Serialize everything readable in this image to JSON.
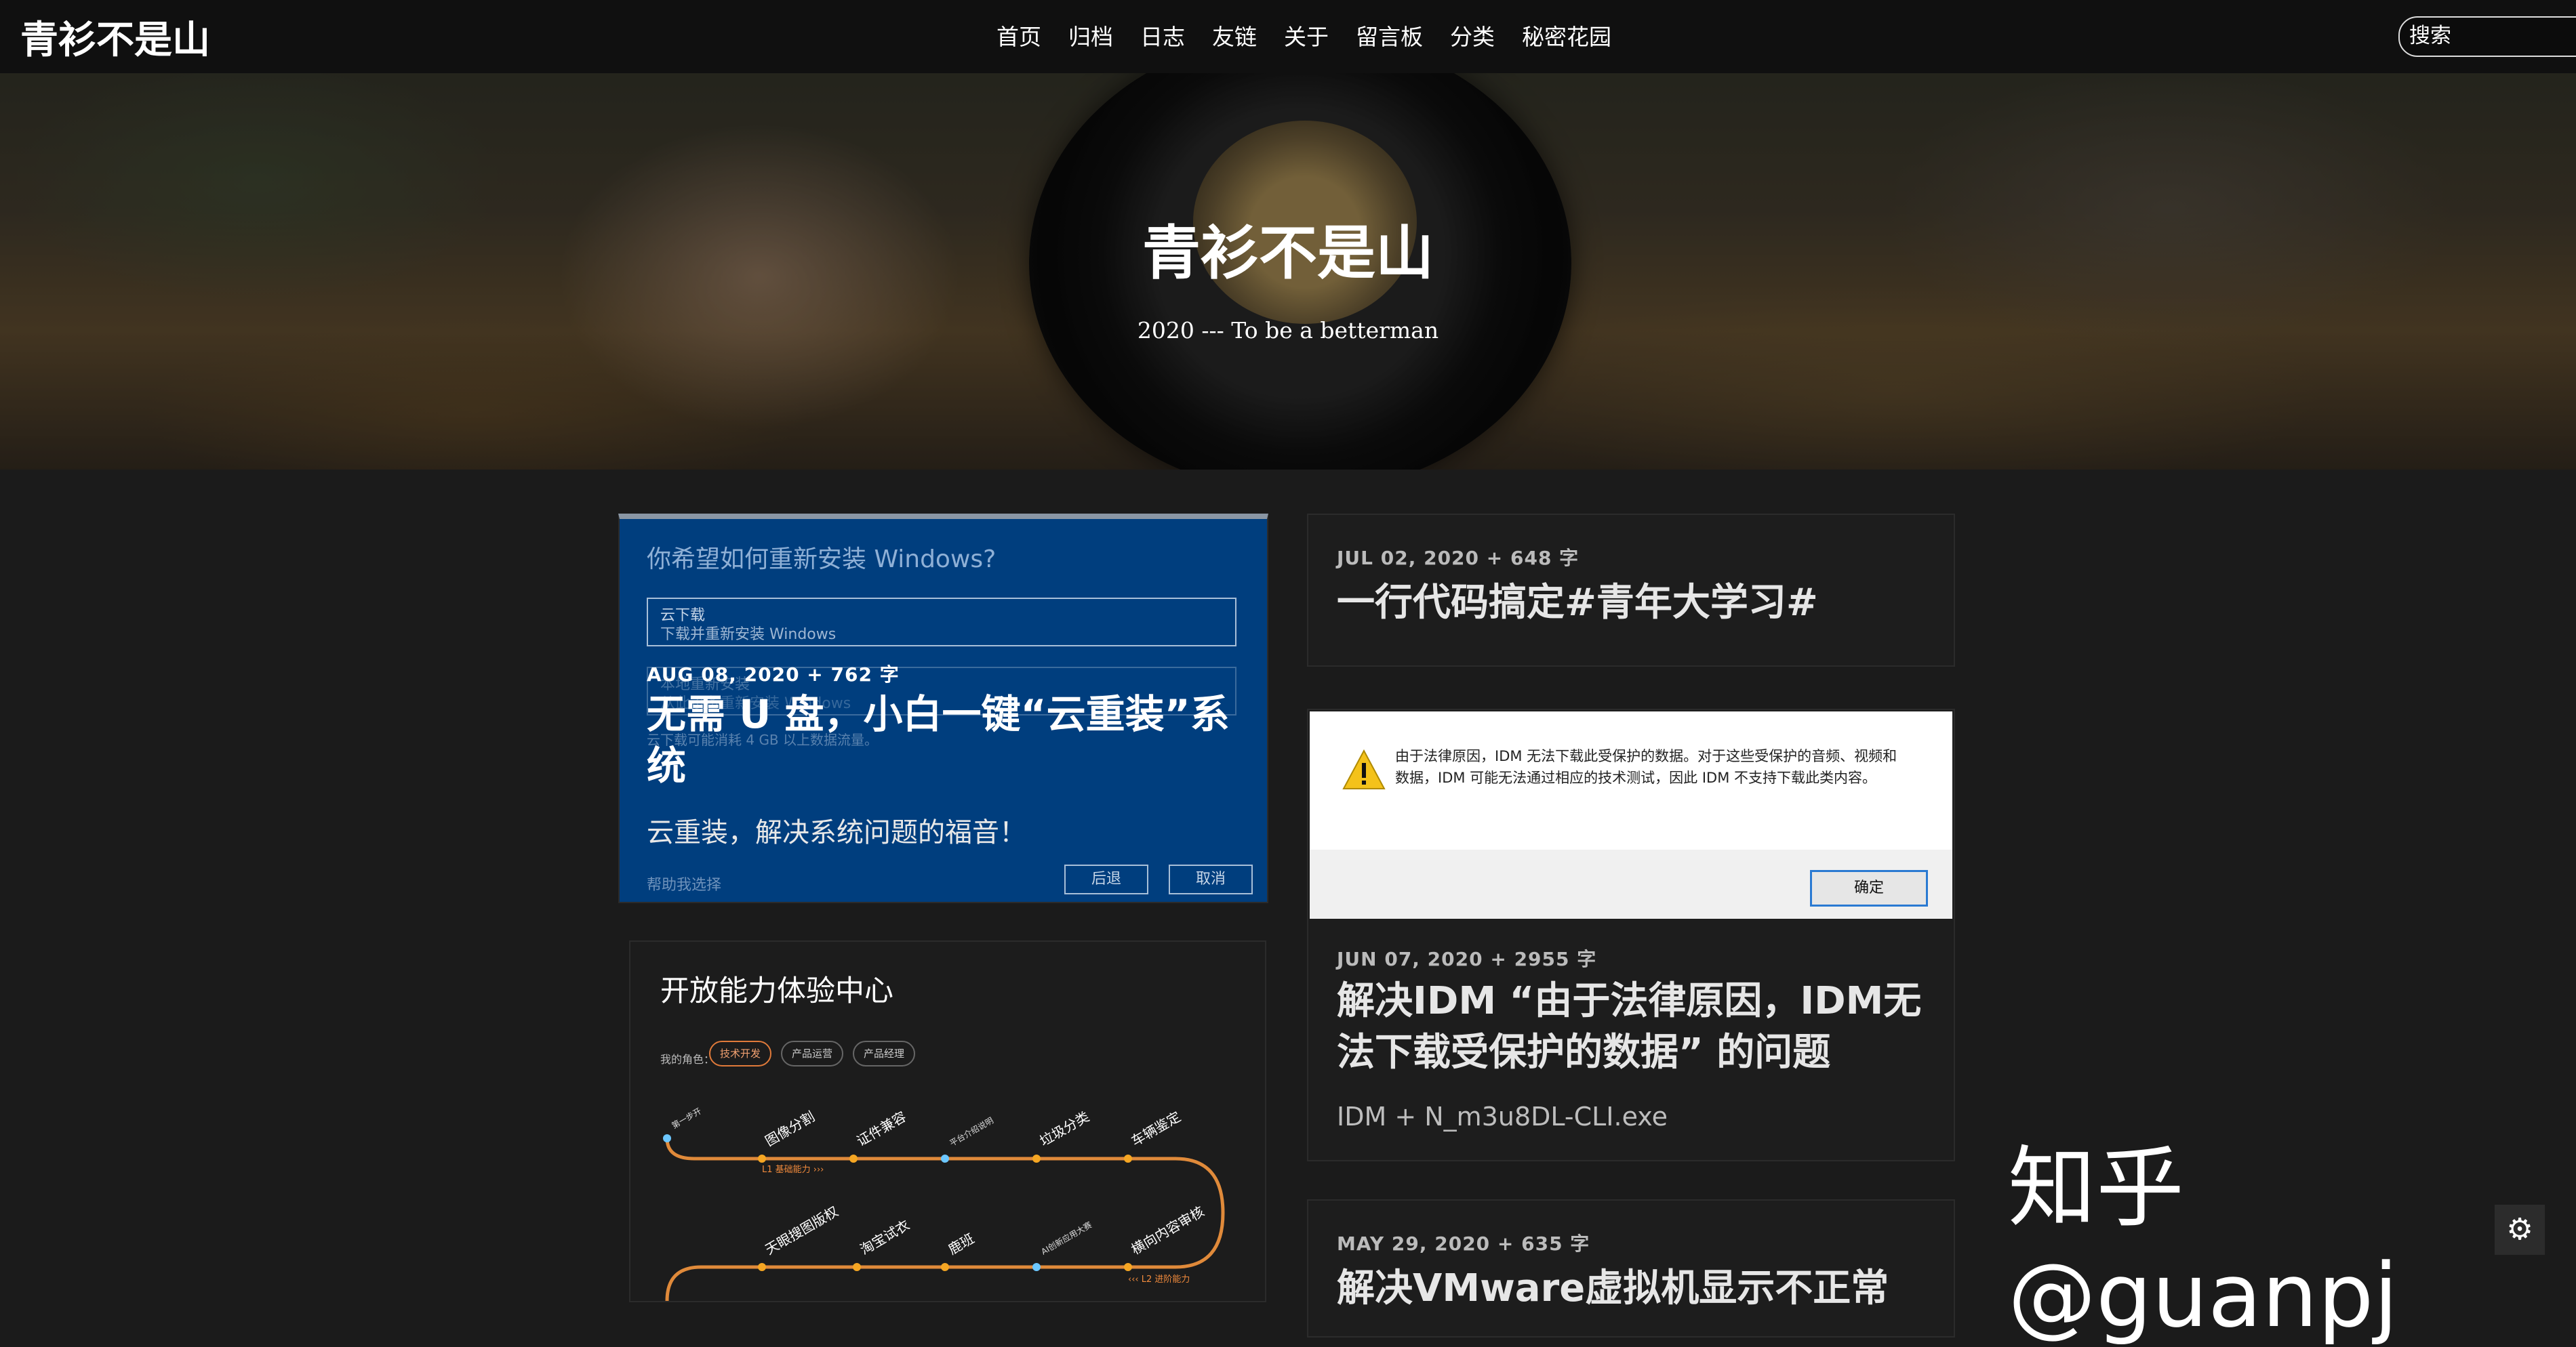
{
  "nav": {
    "brand": "青衫不是山",
    "links": [
      "首页",
      "归档",
      "日志",
      "友链",
      "关于",
      "留言板",
      "分类",
      "秘密花园"
    ],
    "search_placeholder": "搜索"
  },
  "hero": {
    "title": "青衫不是山",
    "subtitle": "2020 --- To be a betterman"
  },
  "posts": [
    {
      "meta": "AUG 08, 2020 + 762 字",
      "title": "无需 U 盘，小白一键“云重装”系统",
      "desc": "云重装，解决系统问题的福音！",
      "image": {
        "heading": "你希望如何重新安装 Windows?",
        "option1_title": "云下载",
        "option1_sub": "下载并重新安装 Windows",
        "option2_title": "本地重新安装",
        "option2_sub": "从此设备重新安装 Windows",
        "note": "云下载可能消耗 4 GB 以上数据流量。",
        "help": "帮助我选择",
        "back": "后退",
        "cancel": "取消"
      }
    },
    {
      "image": {
        "title": "开放能力体验中心",
        "role_label": "我的角色：",
        "chips": [
          "技术开发",
          "产品运营",
          "产品经理"
        ],
        "row1": [
          "第一步开",
          "图像分割",
          "证件兼容",
          "平台介绍说明",
          "垃圾分类",
          "车辆鉴定"
        ],
        "row1_note": "L1 基础能力 ›››",
        "row2": [
          "天眼搜图版权",
          "淘宝试衣",
          "鹿班",
          "AI创新应用大赛",
          "横向内容审核"
        ],
        "row2_note": "‹‹‹ L2 进阶能力"
      }
    },
    {
      "meta": "JUL 02, 2020 + 648 字",
      "title": "一行代码搞定#青年大学习#"
    },
    {
      "meta": "JUN 07, 2020 + 2955 字",
      "title": "解决IDM “由于法律原因，IDM无法下载受保护的数据” 的问题",
      "desc": "IDM + N_m3u8DL-CLI.exe",
      "image": {
        "message": "由于法律原因，IDM 无法下载此受保护的数据。对于这些受保护的音频、视频和数据，IDM 可能无法通过相应的技术测试，因此 IDM 不支持下载此类内容。",
        "ok": "确定"
      }
    },
    {
      "meta": "MAY 29, 2020 + 635 字",
      "title": "解决VMware虚拟机显示不正常"
    }
  ],
  "watermark": "知乎 @guanpj",
  "settings_icon": "⚙"
}
